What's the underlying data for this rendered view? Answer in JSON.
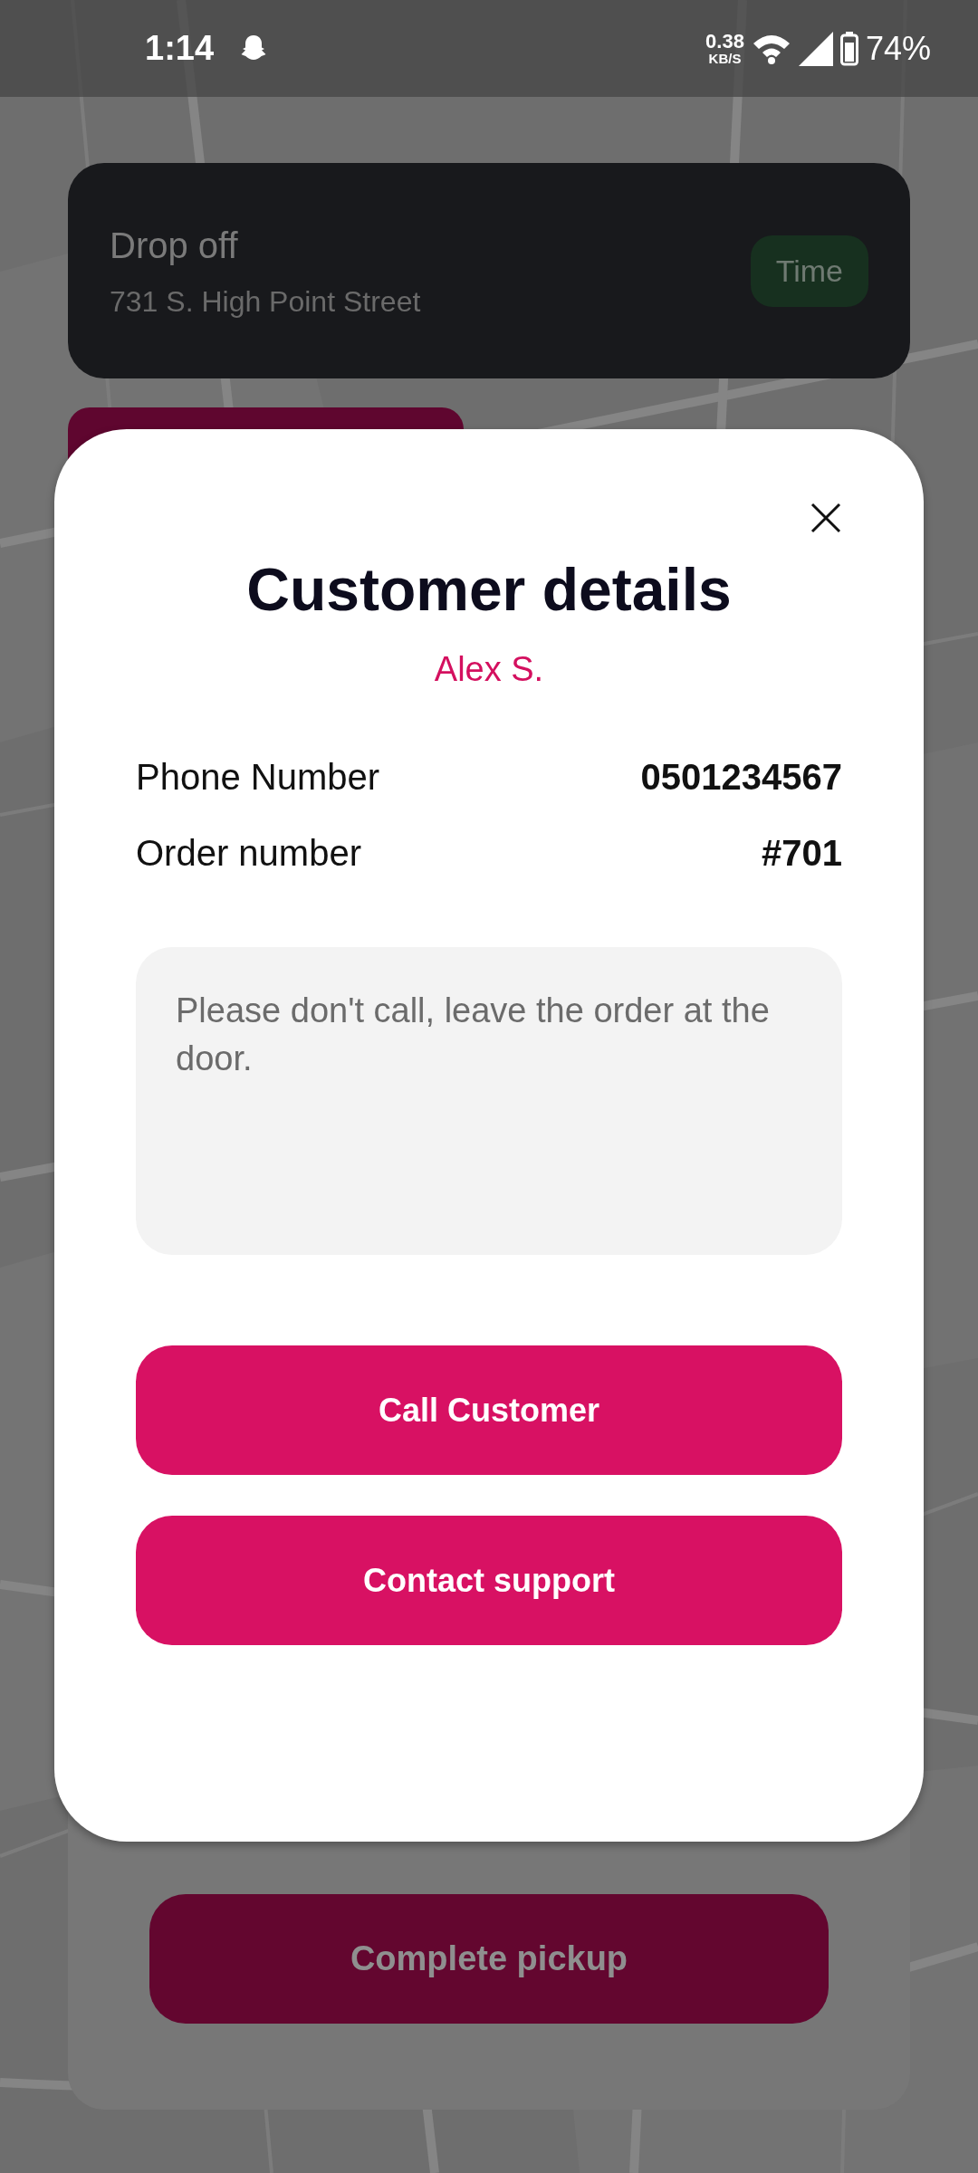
{
  "status_bar": {
    "time": "1:14",
    "net_speed": "0.38",
    "net_unit": "KB/S",
    "battery": "74%"
  },
  "drop_off": {
    "title": "Drop off",
    "address": "731 S. High Point Street",
    "time_button": "Time"
  },
  "bottom_sheet": {
    "button": "Complete pickup"
  },
  "dialog": {
    "title": "Customer details",
    "customer_name": "Alex S.",
    "fields": [
      {
        "label": "Phone Number",
        "value": "0501234567"
      },
      {
        "label": "Order number",
        "value": "#701"
      }
    ],
    "note": "Please don't call, leave the order at the door.",
    "buttons": [
      "Call Customer",
      "Contact support"
    ]
  }
}
